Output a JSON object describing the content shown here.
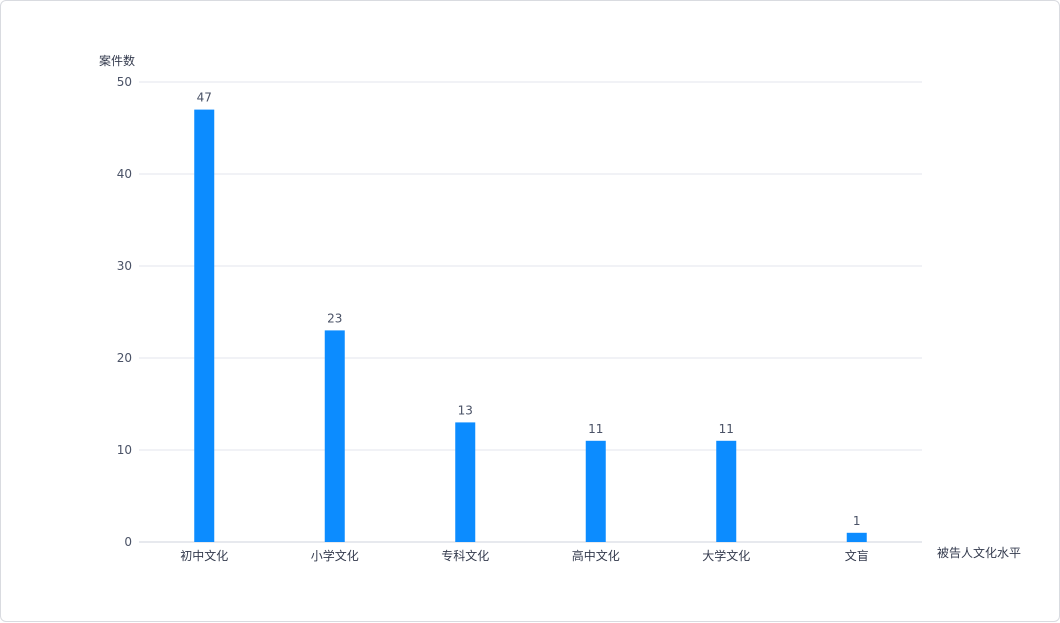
{
  "chart_data": {
    "type": "bar",
    "ylabel": "案件数",
    "xlabel": "被告人文化水平",
    "categories": [
      "初中文化",
      "小学文化",
      "专科文化",
      "高中文化",
      "大学文化",
      "文盲"
    ],
    "values": [
      47,
      23,
      13,
      11,
      11,
      1
    ],
    "ylim": [
      0,
      50
    ],
    "yticks": [
      0,
      10,
      20,
      30,
      40,
      50
    ],
    "grid": true,
    "legend": "none",
    "bar_color": "#0c8cff"
  }
}
